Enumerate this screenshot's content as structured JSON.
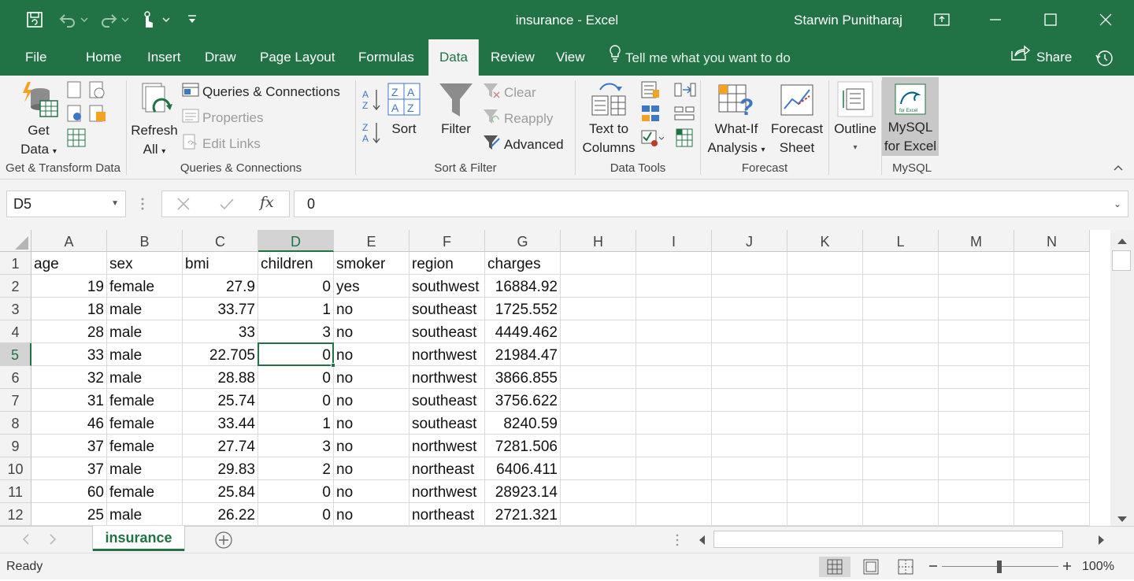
{
  "window": {
    "title": "insurance  -  Excel",
    "user": "Starwin Punitharaj"
  },
  "tabs": [
    {
      "label": "File"
    },
    {
      "label": "Home"
    },
    {
      "label": "Insert"
    },
    {
      "label": "Draw"
    },
    {
      "label": "Page Layout"
    },
    {
      "label": "Formulas"
    },
    {
      "label": "Data"
    },
    {
      "label": "Review"
    },
    {
      "label": "View"
    }
  ],
  "active_tab": "Data",
  "tell_me": "Tell me what you want to do",
  "share": "Share",
  "ribbon": {
    "get_transform": {
      "get_data_line1": "Get",
      "get_data_line2": "Data",
      "label": "Get & Transform Data"
    },
    "queries": {
      "refresh_line1": "Refresh",
      "refresh_line2": "All",
      "queries_connections": "Queries & Connections",
      "properties": "Properties",
      "edit_links": "Edit Links",
      "label": "Queries & Connections"
    },
    "sort_filter": {
      "sort": "Sort",
      "filter": "Filter",
      "clear": "Clear",
      "reapply": "Reapply",
      "advanced": "Advanced",
      "label": "Sort & Filter"
    },
    "data_tools": {
      "text_to_line1": "Text to",
      "text_to_line2": "Columns",
      "label": "Data Tools"
    },
    "forecast": {
      "whatif_line1": "What-If",
      "whatif_line2": "Analysis",
      "forecast_line1": "Forecast",
      "forecast_line2": "Sheet",
      "label": "Forecast"
    },
    "outline": {
      "outline": "Outline"
    },
    "mysql": {
      "btn_line1": "MySQL",
      "btn_line2": "for Excel",
      "label": "MySQL"
    }
  },
  "formula_bar": {
    "name_box": "D5",
    "fx": "fx",
    "value": "0"
  },
  "columns": [
    "A",
    "B",
    "C",
    "D",
    "E",
    "F",
    "G",
    "H",
    "I",
    "J",
    "K",
    "L",
    "M",
    "N"
  ],
  "selected_column": "D",
  "selected_row": "5",
  "rows": [
    {
      "n": "1",
      "cells": [
        "age",
        "sex",
        "bmi",
        "children",
        "smoker",
        "region",
        "charges"
      ]
    },
    {
      "n": "2",
      "cells": [
        "19",
        "female",
        "27.9",
        "0",
        "yes",
        "southwest",
        "16884.92"
      ]
    },
    {
      "n": "3",
      "cells": [
        "18",
        "male",
        "33.77",
        "1",
        "no",
        "southeast",
        "1725.552"
      ]
    },
    {
      "n": "4",
      "cells": [
        "28",
        "male",
        "33",
        "3",
        "no",
        "southeast",
        "4449.462"
      ]
    },
    {
      "n": "5",
      "cells": [
        "33",
        "male",
        "22.705",
        "0",
        "no",
        "northwest",
        "21984.47"
      ]
    },
    {
      "n": "6",
      "cells": [
        "32",
        "male",
        "28.88",
        "0",
        "no",
        "northwest",
        "3866.855"
      ]
    },
    {
      "n": "7",
      "cells": [
        "31",
        "female",
        "25.74",
        "0",
        "no",
        "southeast",
        "3756.622"
      ]
    },
    {
      "n": "8",
      "cells": [
        "46",
        "female",
        "33.44",
        "1",
        "no",
        "southeast",
        "8240.59"
      ]
    },
    {
      "n": "9",
      "cells": [
        "37",
        "female",
        "27.74",
        "3",
        "no",
        "northwest",
        "7281.506"
      ]
    },
    {
      "n": "10",
      "cells": [
        "37",
        "male",
        "29.83",
        "2",
        "no",
        "northeast",
        "6406.411"
      ]
    },
    {
      "n": "11",
      "cells": [
        "60",
        "female",
        "25.84",
        "0",
        "no",
        "northwest",
        "28923.14"
      ]
    },
    {
      "n": "12",
      "cells": [
        "25",
        "male",
        "26.22",
        "0",
        "no",
        "northeast",
        "2721.321"
      ]
    }
  ],
  "sheet_tab": "insurance",
  "status": {
    "text": "Ready",
    "zoom": "100%"
  },
  "colors": {
    "accent": "#217346"
  }
}
